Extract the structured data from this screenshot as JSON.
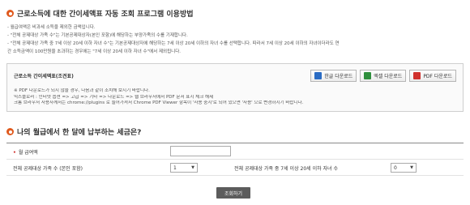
{
  "section1": {
    "title": "근로소득에 대한 간이세액표 자동 조회 프로그램 이용방법",
    "notes": [
      "- 월급여액은 비과세 소득을 제외한 금액입니다.",
      "- \"전체 공제대상 가족 수\"는 기본공제대상자(본인 포함)에 해당하는 부양가족의 수를 기재합니다.",
      "- \"전체 공제대상 가족 중 7세 이상 20세 이하 자녀 수\"는 기본공제대상자에 해당하는 7세 이상 20세 이하의 자녀 수를 선택합니다. 따라서 7세 이상 20세 이하의 자녀이더라도 연",
      "  간 소득금액이 100만원을 초과하는 경우에는 \"7세 이상 20세 이하 자녀 수\"에서 제외됩니다."
    ]
  },
  "download_box": {
    "title": "근로소득 간이세액표(조견표)",
    "buttons": {
      "hwp": "한글 다운로드",
      "excel": "엑셀 다운로드",
      "pdf": "PDF 다운로드"
    },
    "desc": [
      "※ PDF 다운로드가 되지 않을 경우, 다음과 같이 조치해 보시기 바랍니다.",
      "익스플로러 : 인터넷 옵션 => 고급 => 기타 => 다운로드 => 웹 브라우저에서 PDF 문서 표시 체크 해제",
      "크롬 브라우저 사용자께서는 chrome://plugins 로 들어가셔서 Chrome PDF Viewer 항목이 '사용 중지'로 되어 있으면 '사용' 으로 변경하시기 바랍니다."
    ]
  },
  "section2": {
    "title": "나의 월급에서 한 달에 납부하는 세금은?"
  },
  "form": {
    "salary_marker": "•",
    "salary_label": "월 급여액",
    "salary_value": "",
    "family_label": "전체 공제대상 가족 수 (본인 포함)",
    "family_value": "1",
    "children_label": "전체 공제대상 가족 중 7세 이상 20세 이하 자녀 수",
    "children_value": "0",
    "caret": "▼"
  },
  "submit_label": "조회하기",
  "colors": {
    "bullet": "#e05a1e",
    "required": "#d0312d",
    "submit_bg": "#5c5c5c"
  }
}
